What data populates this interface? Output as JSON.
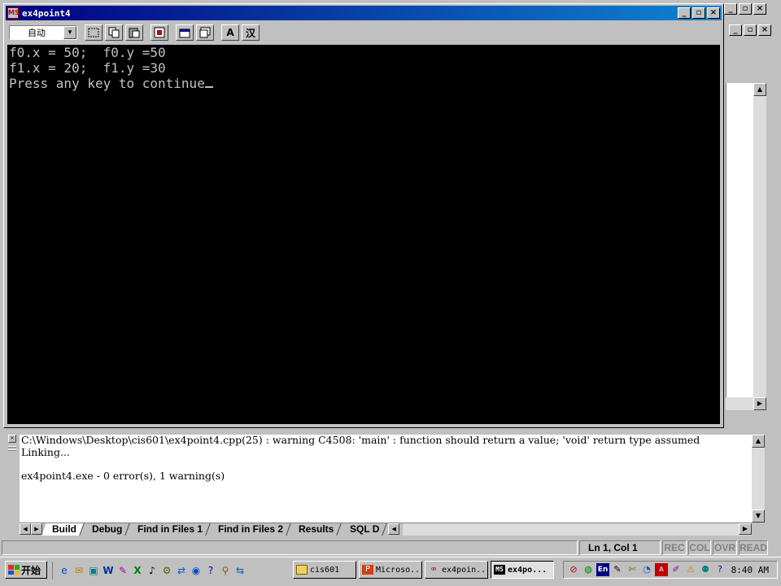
{
  "console": {
    "title": "ex4point4",
    "app_icon_text": "MS",
    "font_select_value": "自动",
    "toolbar_glyphs": {
      "font_a": "A",
      "ime": "汉"
    },
    "lines": [
      "f0.x = 50;  f0.y =50",
      "f1.x = 20;  f1.y =30",
      "Press any key to continue"
    ]
  },
  "window_buttons": {
    "minimize": "_",
    "restore": "▫",
    "close": "×"
  },
  "output": {
    "lines": [
      "C:\\Windows\\Desktop\\cis601\\ex4point4.cpp(25) : warning C4508: 'main' : function should return a value; 'void' return type assumed",
      "Linking...",
      "",
      "ex4point4.exe - 0 error(s), 1 warning(s)"
    ],
    "tabs": [
      "Build",
      "Debug",
      "Find in Files 1",
      "Find in Files 2",
      "Results",
      "SQL D"
    ],
    "active_tab": "Build"
  },
  "statusbar": {
    "position": "Ln 1, Col 1",
    "indicators": [
      "REC",
      "COL",
      "OVR",
      "READ"
    ]
  },
  "taskbar": {
    "start_label": "开始",
    "tasks": [
      {
        "label": "cis601",
        "icon": "folder-icon",
        "active": false
      },
      {
        "label": "Microso...",
        "icon": "powerpoint-icon",
        "active": false
      },
      {
        "label": "ex4poin...",
        "icon": "vc-project-icon",
        "active": false
      },
      {
        "label": "ex4po...",
        "icon": "console-icon",
        "active": true
      }
    ],
    "tray_lang": "En",
    "clock": "8:40 AM"
  },
  "colors": {
    "desktop": "#3a6ea5",
    "title_active_start": "#000080",
    "title_active_end": "#1084d0",
    "console_bg": "#000000",
    "console_fg": "#c0c0c0",
    "chrome": "#c0c0c0"
  }
}
